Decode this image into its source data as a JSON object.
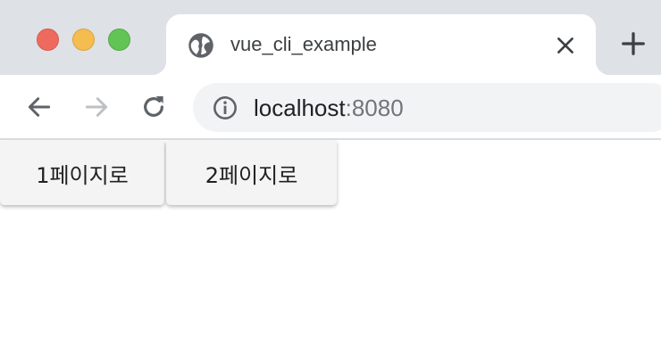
{
  "tab": {
    "title": "vue_cli_example",
    "favicon": "globe-icon",
    "close_icon": "close-icon"
  },
  "new_tab_icon": "plus-icon",
  "window_controls": [
    "close",
    "minimize",
    "maximize"
  ],
  "toolbar": {
    "back_icon": "back-arrow-icon",
    "forward_icon": "forward-arrow-icon",
    "reload_icon": "reload-icon",
    "site_info_icon": "info-icon"
  },
  "address": {
    "host": "localhost",
    "port": ":8080"
  },
  "page": {
    "buttons": [
      {
        "label": "1페이지로"
      },
      {
        "label": "2페이지로"
      }
    ]
  },
  "colors": {
    "tabstrip": "#dee1e6",
    "omnibox": "#f1f3f4",
    "button_bg": "#f4f4f4",
    "traffic_close": "#ee6a5f",
    "traffic_min": "#f5bd4f",
    "traffic_max": "#61c454"
  }
}
